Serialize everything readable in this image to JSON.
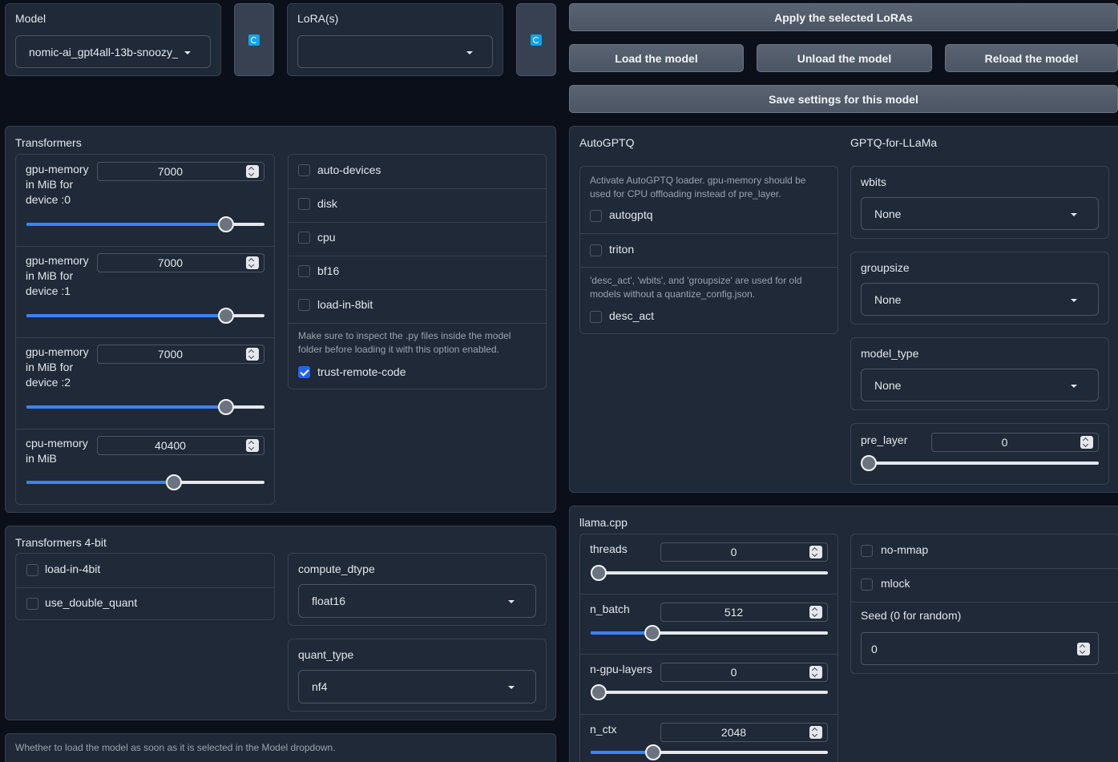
{
  "model": {
    "label": "Model",
    "value": "nomic-ai_gpt4all-13b-snoozy_"
  },
  "lora": {
    "label": "LoRA(s)",
    "value": ""
  },
  "icons": {
    "refresh": "refresh-icon",
    "caret": "chevron-down-icon"
  },
  "buttons": {
    "apply_loras": "Apply the selected LoRAs",
    "load": "Load the model",
    "unload": "Unload the model",
    "reload": "Reload the model",
    "save_settings": "Save settings for this model"
  },
  "transformers": {
    "title": "Transformers",
    "memory": [
      {
        "label": "gpu-memory in MiB for device :0",
        "value": "7000",
        "fraction": 0.84
      },
      {
        "label": "gpu-memory in MiB for device :1",
        "value": "7000",
        "fraction": 0.84
      },
      {
        "label": "gpu-memory in MiB for device :2",
        "value": "7000",
        "fraction": 0.84
      },
      {
        "label": "cpu-memory in MiB",
        "value": "40400",
        "fraction": 0.62
      }
    ],
    "options": [
      {
        "label": "auto-devices",
        "checked": false
      },
      {
        "label": "disk",
        "checked": false
      },
      {
        "label": "cpu",
        "checked": false
      },
      {
        "label": "bf16",
        "checked": false
      },
      {
        "label": "load-in-8bit",
        "checked": false
      }
    ],
    "trust_hint": "Make sure to inspect the .py files inside the model folder before loading it with this option enabled.",
    "trust_label": "trust-remote-code",
    "trust_checked": true
  },
  "transformers4bit": {
    "title": "Transformers 4-bit",
    "load_in_4bit": "load-in-4bit",
    "use_double_quant": "use_double_quant",
    "compute_dtype": {
      "label": "compute_dtype",
      "value": "float16"
    },
    "quant_type": {
      "label": "quant_type",
      "value": "nf4"
    }
  },
  "autoload_hint": "Whether to load the model as soon as it is selected in the Model dropdown.",
  "autogptq": {
    "title": "AutoGPTQ",
    "hint1": "Activate AutoGPTQ loader. gpu-memory should be used for CPU offloading instead of pre_layer.",
    "autogptq": "autogptq",
    "triton": "triton",
    "hint2": "'desc_act', 'wbits', and 'groupsize' are used for old models without a quantize_config.json.",
    "desc_act": "desc_act"
  },
  "gptq": {
    "title": "GPTQ-for-LLaMa",
    "wbits": {
      "label": "wbits",
      "value": "None"
    },
    "groupsize": {
      "label": "groupsize",
      "value": "None"
    },
    "model_type": {
      "label": "model_type",
      "value": "None"
    },
    "pre_layer": {
      "label": "pre_layer",
      "value": "0",
      "fraction": 0
    }
  },
  "llamacpp": {
    "title": "llama.cpp",
    "sliders": [
      {
        "label": "threads",
        "value": "0",
        "fraction": 0
      },
      {
        "label": "n_batch",
        "value": "512",
        "fraction": 0.23
      },
      {
        "label": "n-gpu-layers",
        "value": "0",
        "fraction": 0
      },
      {
        "label": "n_ctx",
        "value": "2048",
        "fraction": 0.23
      }
    ],
    "no_mmap": "no-mmap",
    "mlock": "mlock",
    "seed": {
      "label": "Seed (0 for random)",
      "value": "0"
    }
  }
}
